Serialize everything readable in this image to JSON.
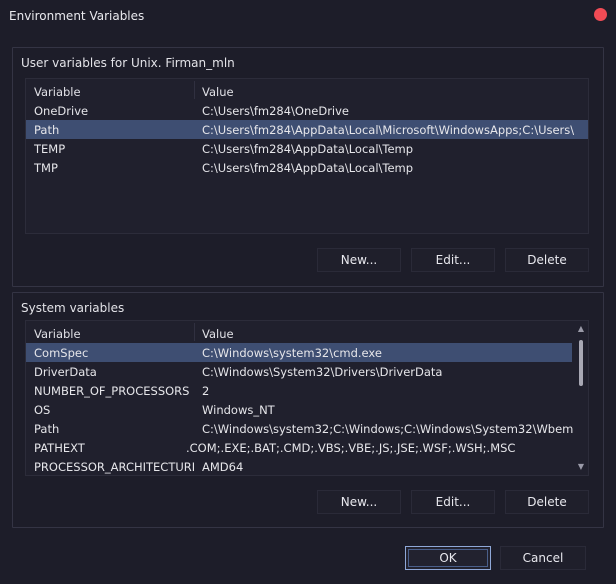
{
  "window": {
    "title": "Environment Variables"
  },
  "user_section": {
    "label": "User variables for Unix. Firman_mln",
    "columns": {
      "variable": "Variable",
      "value": "Value"
    },
    "rows": [
      {
        "variable": "OneDrive",
        "value": "C:\\Users\\fm284\\OneDrive"
      },
      {
        "variable": "Path",
        "value": "C:\\Users\\fm284\\AppData\\Local\\Microsoft\\WindowsApps;C:\\Users\\..."
      },
      {
        "variable": "TEMP",
        "value": "C:\\Users\\fm284\\AppData\\Local\\Temp"
      },
      {
        "variable": "TMP",
        "value": "C:\\Users\\fm284\\AppData\\Local\\Temp"
      }
    ],
    "buttons": {
      "new": "New...",
      "edit": "Edit...",
      "delete": "Delete"
    }
  },
  "system_section": {
    "label": "System variables",
    "columns": {
      "variable": "Variable",
      "value": "Value"
    },
    "rows": [
      {
        "variable": "ComSpec",
        "value": "C:\\Windows\\system32\\cmd.exe"
      },
      {
        "variable": "DriverData",
        "value": "C:\\Windows\\System32\\Drivers\\DriverData"
      },
      {
        "variable": "NUMBER_OF_PROCESSORS",
        "value": "2"
      },
      {
        "variable": "OS",
        "value": "Windows_NT"
      },
      {
        "variable": "Path",
        "value": "C:\\Windows\\system32;C:\\Windows;C:\\Windows\\System32\\Wbem;..."
      },
      {
        "variable": "PATHEXT",
        "value": ".COM;.EXE;.BAT;.CMD;.VBS;.VBE;.JS;.JSE;.WSF;.WSH;.MSC"
      },
      {
        "variable": "PROCESSOR_ARCHITECTURE",
        "value": "AMD64"
      }
    ],
    "buttons": {
      "new": "New...",
      "edit": "Edit...",
      "delete": "Delete"
    }
  },
  "footer": {
    "ok": "OK",
    "cancel": "Cancel"
  },
  "colors": {
    "background": "#1d1d29",
    "selection": "#3e4e72",
    "close": "#f04b55"
  },
  "icons": {
    "close": "close-dot-icon",
    "scroll_up": "chevron-up-icon",
    "scroll_down": "chevron-down-icon"
  }
}
